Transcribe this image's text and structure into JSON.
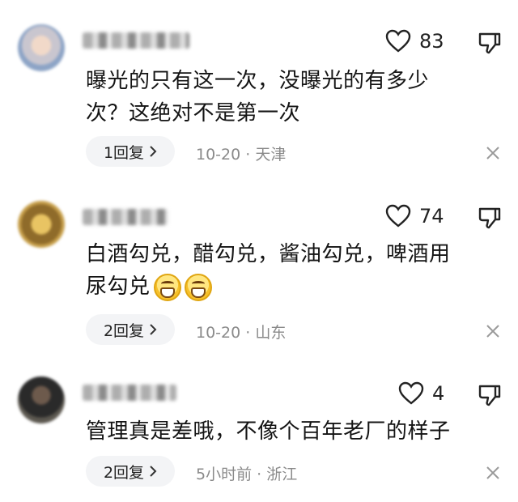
{
  "comments": [
    {
      "likes": "83",
      "text_lines": [
        "曝光的只有这一次，没曝光的有多少",
        "次？这绝对不是第一次"
      ],
      "reply_label": "1回复",
      "time": "10-20",
      "location": "天津"
    },
    {
      "likes": "74",
      "text_lines": [
        "白酒勾兑，醋勾兑，酱油勾兑，啤酒用",
        "尿勾兑"
      ],
      "emojis": [
        "grinning-emoji",
        "grinning-emoji"
      ],
      "reply_label": "2回复",
      "time": "10-20",
      "location": "山东"
    },
    {
      "likes": "4",
      "text_lines": [
        "管理真是差哦，不像个百年老厂的样子"
      ],
      "reply_label": "2回复",
      "time": "5小时前",
      "location": "浙江"
    }
  ],
  "separator": "·",
  "icons": {
    "like": "heart-outline-icon",
    "dislike": "thumbs-down-icon",
    "dismiss": "close-icon",
    "reply_arrow": "chevron-right-icon"
  },
  "colors": {
    "text": "#141414",
    "meta": "#8a8a8a",
    "pill_bg": "#f3f4f6"
  }
}
